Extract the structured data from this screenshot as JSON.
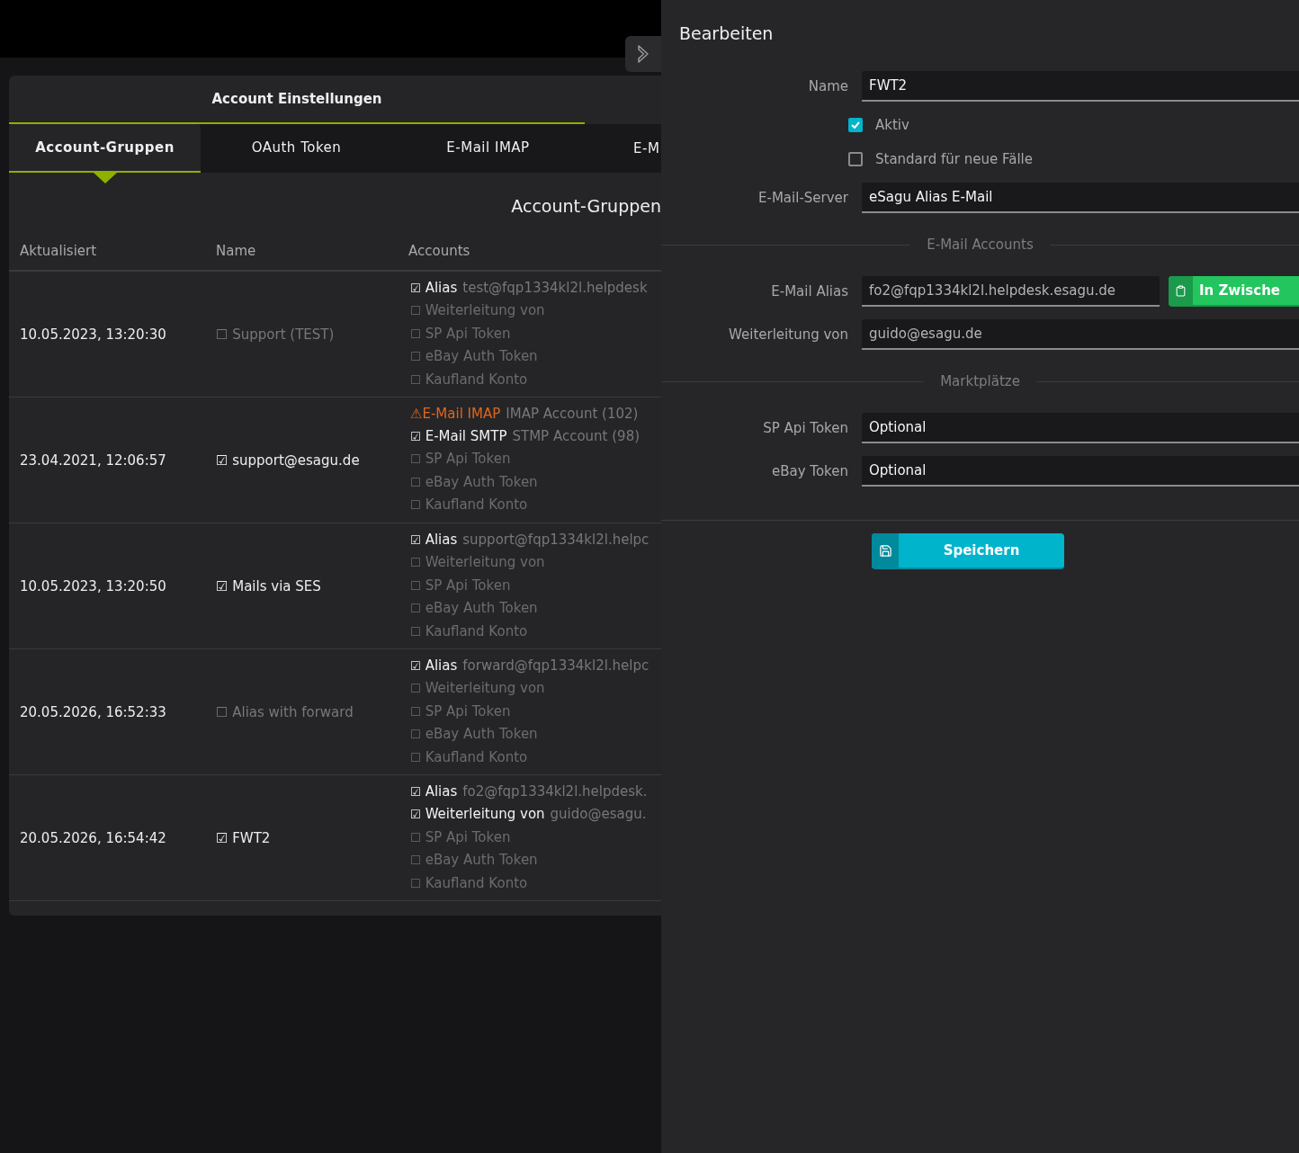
{
  "panel_title": "Account Einstellungen",
  "tabs": [
    {
      "label": "Account-Gruppen",
      "selected": true
    },
    {
      "label": "OAuth Token",
      "selected": false
    },
    {
      "label": "E-Mail IMAP",
      "selected": false
    },
    {
      "label": "E-M",
      "selected": false
    }
  ],
  "section_title": "Account-Gruppen",
  "table": {
    "columns": [
      "Aktualisiert",
      "Name",
      "Accounts"
    ],
    "rows": [
      {
        "updated": "10.05.2023, 13:20:30",
        "name": {
          "mark": "☐",
          "text": "Support (TEST)",
          "active": false
        },
        "accounts": [
          {
            "kind": "checked",
            "mark": "☑",
            "label": "Alias",
            "value": "test@fqp1334kl2l.helpdesk"
          },
          {
            "kind": "unchecked",
            "mark": "☐",
            "label": "Weiterleitung von"
          },
          {
            "kind": "unchecked",
            "mark": "☐",
            "label": "SP Api Token"
          },
          {
            "kind": "unchecked",
            "mark": "☐",
            "label": "eBay Auth Token"
          },
          {
            "kind": "unchecked",
            "mark": "☐",
            "label": "Kaufland Konto"
          }
        ]
      },
      {
        "updated": "23.04.2021, 12:06:57",
        "name": {
          "mark": "☑",
          "text": "support@esagu.de",
          "active": true
        },
        "accounts": [
          {
            "kind": "warning",
            "mark": "⚠",
            "label": "E-Mail IMAP",
            "value": "IMAP Account (102)"
          },
          {
            "kind": "checked",
            "mark": "☑",
            "label": "E-Mail SMTP",
            "value": "STMP Account (98)"
          },
          {
            "kind": "unchecked",
            "mark": "☐",
            "label": "SP Api Token"
          },
          {
            "kind": "unchecked",
            "mark": "☐",
            "label": "eBay Auth Token"
          },
          {
            "kind": "unchecked",
            "mark": "☐",
            "label": "Kaufland Konto"
          }
        ]
      },
      {
        "updated": "10.05.2023, 13:20:50",
        "name": {
          "mark": "☑",
          "text": "Mails via SES",
          "active": true
        },
        "accounts": [
          {
            "kind": "checked",
            "mark": "☑",
            "label": "Alias",
            "value": "support@fqp1334kl2l.helpc"
          },
          {
            "kind": "unchecked",
            "mark": "☐",
            "label": "Weiterleitung von"
          },
          {
            "kind": "unchecked",
            "mark": "☐",
            "label": "SP Api Token"
          },
          {
            "kind": "unchecked",
            "mark": "☐",
            "label": "eBay Auth Token"
          },
          {
            "kind": "unchecked",
            "mark": "☐",
            "label": "Kaufland Konto"
          }
        ]
      },
      {
        "updated": "20.05.2026, 16:52:33",
        "name": {
          "mark": "☐",
          "text": "Alias with forward",
          "active": false
        },
        "accounts": [
          {
            "kind": "checked",
            "mark": "☑",
            "label": "Alias",
            "value": "forward@fqp1334kl2l.helpc"
          },
          {
            "kind": "unchecked",
            "mark": "☐",
            "label": "Weiterleitung von"
          },
          {
            "kind": "unchecked",
            "mark": "☐",
            "label": "SP Api Token"
          },
          {
            "kind": "unchecked",
            "mark": "☐",
            "label": "eBay Auth Token"
          },
          {
            "kind": "unchecked",
            "mark": "☐",
            "label": "Kaufland Konto"
          }
        ]
      },
      {
        "updated": "20.05.2026, 16:54:42",
        "name": {
          "mark": "☑",
          "text": "FWT2",
          "active": true
        },
        "accounts": [
          {
            "kind": "checked",
            "mark": "☑",
            "label": "Alias",
            "value": "fo2@fqp1334kl2l.helpdesk."
          },
          {
            "kind": "checked",
            "mark": "☑",
            "label": "Weiterleitung von",
            "value": "guido@esagu."
          },
          {
            "kind": "unchecked",
            "mark": "☐",
            "label": "SP Api Token"
          },
          {
            "kind": "unchecked",
            "mark": "☐",
            "label": "eBay Auth Token"
          },
          {
            "kind": "unchecked",
            "mark": "☐",
            "label": "Kaufland Konto"
          }
        ]
      }
    ]
  },
  "drawer": {
    "title": "Bearbeiten",
    "items": [
      {
        "kind": "text",
        "label": "Name",
        "value": "FWT2",
        "dimmed": false
      },
      {
        "kind": "checkbox",
        "label": "Aktiv",
        "checked": true
      },
      {
        "kind": "checkbox",
        "label": "Standard für neue Fälle",
        "checked": false
      },
      {
        "kind": "text",
        "label": "E-Mail-Server",
        "value": "eSagu Alias E-Mail",
        "dimmed": false
      },
      {
        "kind": "divider",
        "label": "E-Mail Accounts"
      },
      {
        "kind": "copy",
        "label": "E-Mail Alias",
        "value": "fo2@fqp1334kl2l.helpdesk.esagu.de",
        "dimmed": true,
        "button": "In Zwische"
      },
      {
        "kind": "text",
        "label": "Weiterleitung von",
        "value": "guido@esagu.de",
        "dimmed": true
      },
      {
        "kind": "divider",
        "label": "Marktplätze"
      },
      {
        "kind": "text",
        "label": "SP Api Token",
        "value": "Optional",
        "dimmed": false
      },
      {
        "kind": "text",
        "label": "eBay Token",
        "value": "Optional",
        "dimmed": false
      }
    ],
    "save_button": "Speichern"
  }
}
